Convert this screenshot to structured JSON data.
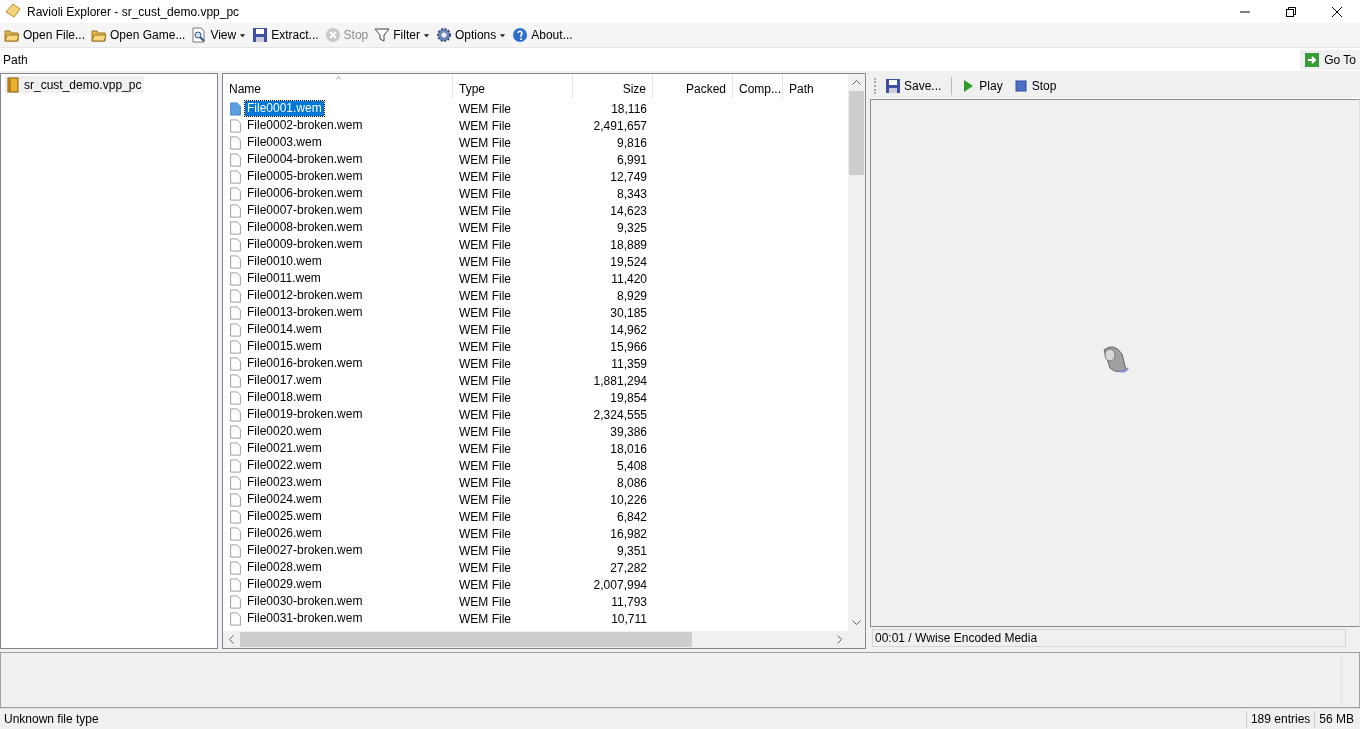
{
  "window": {
    "title": "Ravioli Explorer - sr_cust_demo.vpp_pc"
  },
  "toolbar": [
    {
      "kind": "folder",
      "label": "Open File...",
      "disabled": false,
      "dropdown": false
    },
    {
      "kind": "folder",
      "label": "Open Game...",
      "disabled": false,
      "dropdown": false
    },
    {
      "kind": "view",
      "label": "View",
      "disabled": false,
      "dropdown": true
    },
    {
      "kind": "save",
      "label": "Extract...",
      "disabled": false,
      "dropdown": false
    },
    {
      "kind": "stop",
      "label": "Stop",
      "disabled": true,
      "dropdown": false
    },
    {
      "kind": "filter",
      "label": "Filter",
      "disabled": false,
      "dropdown": true
    },
    {
      "kind": "gear",
      "label": "Options",
      "disabled": false,
      "dropdown": true
    },
    {
      "kind": "help",
      "label": "About...",
      "disabled": false,
      "dropdown": false
    }
  ],
  "path_bar": {
    "label": "Path",
    "go_button": "Go To"
  },
  "tree": {
    "items": [
      {
        "label": "sr_cust_demo.vpp_pc",
        "selected": false
      }
    ]
  },
  "file_list": {
    "columns": [
      {
        "label": "Name",
        "sorted": true
      },
      {
        "label": "Type",
        "sorted": false
      },
      {
        "label": "Size",
        "sorted": false
      },
      {
        "label": "Packed",
        "sorted": false
      },
      {
        "label": "Comp...",
        "sorted": false
      },
      {
        "label": "Path",
        "sorted": false
      }
    ],
    "rows": [
      {
        "name": "File0001.wem",
        "type": "WEM File",
        "size": "18,116",
        "selected": true
      },
      {
        "name": "File0002-broken.wem",
        "type": "WEM File",
        "size": "2,491,657",
        "selected": false
      },
      {
        "name": "File0003.wem",
        "type": "WEM File",
        "size": "9,816",
        "selected": false
      },
      {
        "name": "File0004-broken.wem",
        "type": "WEM File",
        "size": "6,991",
        "selected": false
      },
      {
        "name": "File0005-broken.wem",
        "type": "WEM File",
        "size": "12,749",
        "selected": false
      },
      {
        "name": "File0006-broken.wem",
        "type": "WEM File",
        "size": "8,343",
        "selected": false
      },
      {
        "name": "File0007-broken.wem",
        "type": "WEM File",
        "size": "14,623",
        "selected": false
      },
      {
        "name": "File0008-broken.wem",
        "type": "WEM File",
        "size": "9,325",
        "selected": false
      },
      {
        "name": "File0009-broken.wem",
        "type": "WEM File",
        "size": "18,889",
        "selected": false
      },
      {
        "name": "File0010.wem",
        "type": "WEM File",
        "size": "19,524",
        "selected": false
      },
      {
        "name": "File0011.wem",
        "type": "WEM File",
        "size": "11,420",
        "selected": false
      },
      {
        "name": "File0012-broken.wem",
        "type": "WEM File",
        "size": "8,929",
        "selected": false
      },
      {
        "name": "File0013-broken.wem",
        "type": "WEM File",
        "size": "30,185",
        "selected": false
      },
      {
        "name": "File0014.wem",
        "type": "WEM File",
        "size": "14,962",
        "selected": false
      },
      {
        "name": "File0015.wem",
        "type": "WEM File",
        "size": "15,966",
        "selected": false
      },
      {
        "name": "File0016-broken.wem",
        "type": "WEM File",
        "size": "11,359",
        "selected": false
      },
      {
        "name": "File0017.wem",
        "type": "WEM File",
        "size": "1,881,294",
        "selected": false
      },
      {
        "name": "File0018.wem",
        "type": "WEM File",
        "size": "19,854",
        "selected": false
      },
      {
        "name": "File0019-broken.wem",
        "type": "WEM File",
        "size": "2,324,555",
        "selected": false
      },
      {
        "name": "File0020.wem",
        "type": "WEM File",
        "size": "39,386",
        "selected": false
      },
      {
        "name": "File0021.wem",
        "type": "WEM File",
        "size": "18,016",
        "selected": false
      },
      {
        "name": "File0022.wem",
        "type": "WEM File",
        "size": "5,408",
        "selected": false
      },
      {
        "name": "File0023.wem",
        "type": "WEM File",
        "size": "8,086",
        "selected": false
      },
      {
        "name": "File0024.wem",
        "type": "WEM File",
        "size": "10,226",
        "selected": false
      },
      {
        "name": "File0025.wem",
        "type": "WEM File",
        "size": "6,842",
        "selected": false
      },
      {
        "name": "File0026.wem",
        "type": "WEM File",
        "size": "16,982",
        "selected": false
      },
      {
        "name": "File0027-broken.wem",
        "type": "WEM File",
        "size": "9,351",
        "selected": false
      },
      {
        "name": "File0028.wem",
        "type": "WEM File",
        "size": "27,282",
        "selected": false
      },
      {
        "name": "File0029.wem",
        "type": "WEM File",
        "size": "2,007,994",
        "selected": false
      },
      {
        "name": "File0030-broken.wem",
        "type": "WEM File",
        "size": "11,793",
        "selected": false
      },
      {
        "name": "File0031-broken.wem",
        "type": "WEM File",
        "size": "10,711",
        "selected": false
      }
    ]
  },
  "preview": {
    "toolbar": [
      {
        "kind": "save",
        "label": "Save..."
      },
      {
        "kind": "play",
        "label": "Play"
      },
      {
        "kind": "stop",
        "label": "Stop"
      }
    ],
    "status": "00:01 / Wwise Encoded Media"
  },
  "status_bar": {
    "message": "Unknown file type",
    "entries": "189 entries",
    "size": "56 MB"
  }
}
